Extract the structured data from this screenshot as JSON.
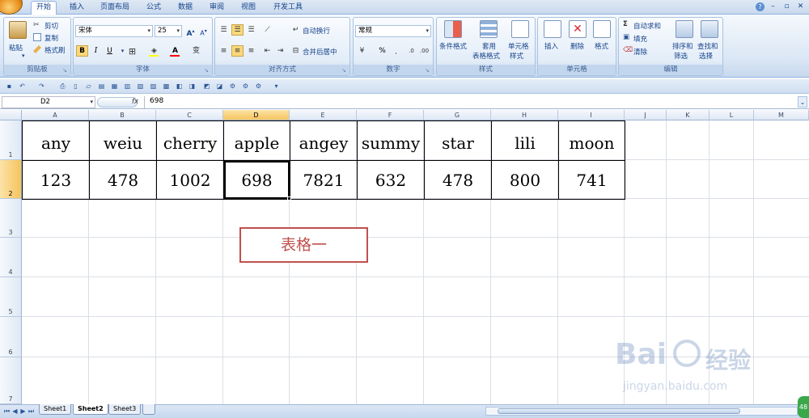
{
  "tabs": {
    "items": [
      {
        "label": "开始",
        "active": true
      },
      {
        "label": "插入"
      },
      {
        "label": "页面布局"
      },
      {
        "label": "公式"
      },
      {
        "label": "数据"
      },
      {
        "label": "审阅"
      },
      {
        "label": "视图"
      },
      {
        "label": "开发工具"
      }
    ]
  },
  "ribbon": {
    "clipboard": {
      "paste": "粘贴",
      "cut": "剪切",
      "copy": "复制",
      "format_painter": "格式刷",
      "label": "剪贴板"
    },
    "font": {
      "name": "宋体",
      "size": "25",
      "bold": "B",
      "italic": "I",
      "underline": "U",
      "label": "字体"
    },
    "alignment": {
      "wrap": "自动换行",
      "merge": "合并后居中",
      "label": "对齐方式"
    },
    "number": {
      "format": "常规",
      "percent": "%",
      "label": "数字"
    },
    "styles": {
      "conditional": "条件格式",
      "table": "套用",
      "table2": "表格格式",
      "cell": "单元格",
      "cell2": "样式",
      "label": "样式"
    },
    "cells": {
      "insert": "插入",
      "delete": "删除",
      "format": "格式",
      "label": "单元格"
    },
    "editing": {
      "autosum": "自动求和",
      "fill": "填充",
      "clear": "清除",
      "sort": "排序和",
      "sort2": "筛选",
      "find": "查找和",
      "find2": "选择",
      "label": "编辑"
    }
  },
  "formula_bar": {
    "name_box": "D2",
    "fx": "fx",
    "value": "698"
  },
  "sheet": {
    "columns": [
      "A",
      "B",
      "C",
      "D",
      "E",
      "F",
      "G",
      "H",
      "I",
      "J",
      "K",
      "L",
      "M"
    ],
    "selected_column": "D",
    "rows": [
      "1",
      "2",
      "3",
      "4",
      "5",
      "6",
      "7"
    ],
    "selected_row": "2",
    "row1": [
      "any",
      "weiu",
      "cherry",
      "apple",
      "angey",
      "summy",
      "star",
      "lili",
      "moon"
    ],
    "row2": [
      "123",
      "478",
      "1002",
      "698",
      "7821",
      "632",
      "478",
      "800",
      "741"
    ],
    "note": "表格一"
  },
  "sheet_tabs": [
    {
      "label": "Sheet1"
    },
    {
      "label": "Sheet2",
      "active": true
    },
    {
      "label": "Sheet3"
    }
  ],
  "watermark": {
    "brand": "Bai",
    "cn": "经验",
    "url": "jingyan.baidu.com"
  },
  "colors": {
    "accent": "#15428b",
    "selection": "#f6c45c",
    "note_border": "#c0504d"
  }
}
